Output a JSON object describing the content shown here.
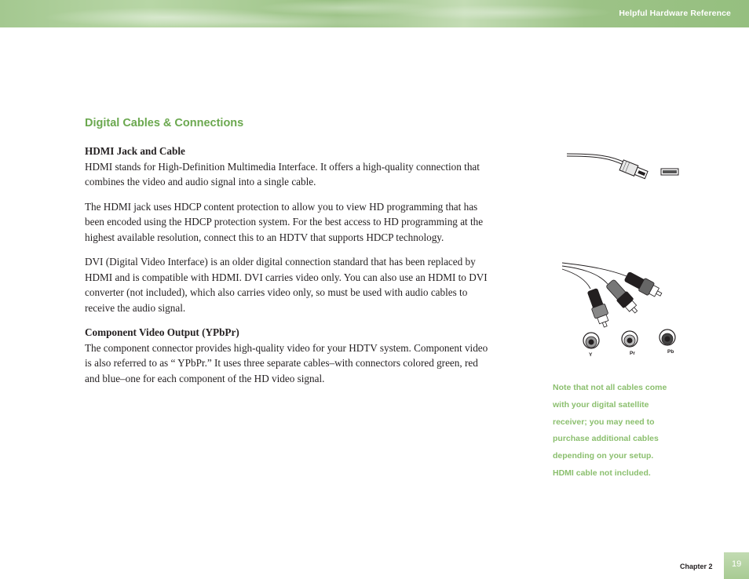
{
  "header": {
    "title": "Helpful Hardware Reference"
  },
  "section": {
    "title": "Digital Cables & Connections"
  },
  "content": {
    "hdmi": {
      "heading": "HDMI Jack and Cable",
      "paragraphs": [
        "HDMI stands for High-Definition Multimedia Interface. It offers a high-quality connection that combines the video and audio signal into a single cable.",
        "The HDMI jack uses HDCP content protection to allow you to view HD programming that has been encoded using the HDCP protection system. For the best access to HD programming at the highest available resolution, connect this to an HDTV that supports HDCP technology.",
        "DVI (Digital Video Interface) is an older digital connection standard that has been replaced by HDMI and is compatible with HDMI.  DVI carries video only.  You can also use an HDMI to DVI converter (not included), which also carries video only, so must be used with audio cables to receive the audio signal."
      ]
    },
    "component": {
      "heading": "Component Video Output (YPbPr)",
      "paragraphs": [
        "The component connector provides high-quality video for your HDTV system. Component video is also referred to as “ YPbPr.” It uses three separate cables–with connectors colored green, red and blue–one for each component of the HD video signal."
      ]
    }
  },
  "figures": {
    "hdmi": {
      "icon": "hdmi-cable-and-jack-illustration"
    },
    "component": {
      "icon": "component-rca-cables-illustration",
      "jack_labels": [
        "Y",
        "Pr",
        "Pb"
      ]
    }
  },
  "note": {
    "lines": [
      "Note that not all cables come",
      "with your digital satellite",
      "receiver; you may need to",
      "purchase additional cables",
      "depending on your setup.",
      "HDMI cable not included."
    ]
  },
  "footer": {
    "chapter": "Chapter 2",
    "page_number": "19"
  },
  "colors": {
    "accent_green": "#6ba84f",
    "note_green": "#8bbf6e",
    "header_green": "#a4c890"
  }
}
